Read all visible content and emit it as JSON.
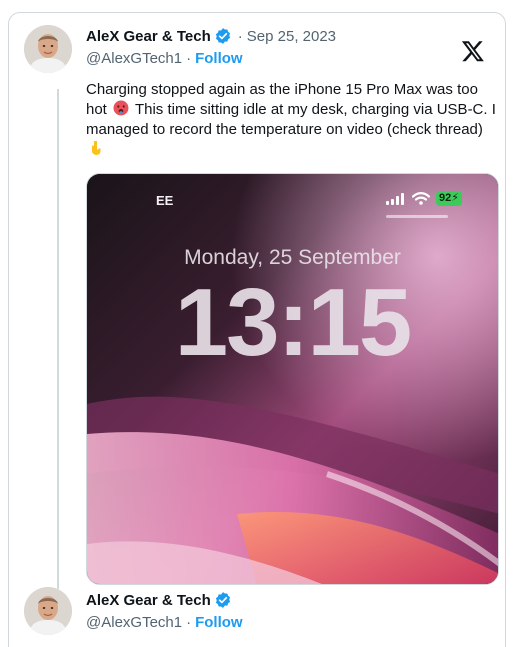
{
  "tweet": {
    "author_name": "AleX Gear & Tech",
    "date_separator": "·",
    "date": "Sep 25, 2023",
    "handle": "@AlexGTech1",
    "handle_separator": "·",
    "follow_label": "Follow",
    "text_part1": "Charging stopped again as the iPhone 15 Pro Max was too hot",
    "text_part2": " This time sitting idle at my desk, charging via USB-C. I managed to record the temperature on video (check thread)",
    "emoji_1": "hot-face-emoji",
    "emoji_2": "pointing-down-emoji",
    "media": {
      "carrier": "EE",
      "battery": "92",
      "lock_date": "Monday, 25 September",
      "lock_time": "13:15"
    }
  },
  "reply": {
    "author_name": "AleX Gear & Tech",
    "handle": "@AlexGTech1",
    "handle_separator": "·",
    "follow_label": "Follow"
  },
  "colors": {
    "accent": "#1d9bf0",
    "text": "#0f1419",
    "muted": "#536471",
    "border": "#cfd9de"
  },
  "icons": [
    "x-logo-icon",
    "verified-badge-icon",
    "signal-icon",
    "wifi-icon",
    "battery-icon"
  ]
}
